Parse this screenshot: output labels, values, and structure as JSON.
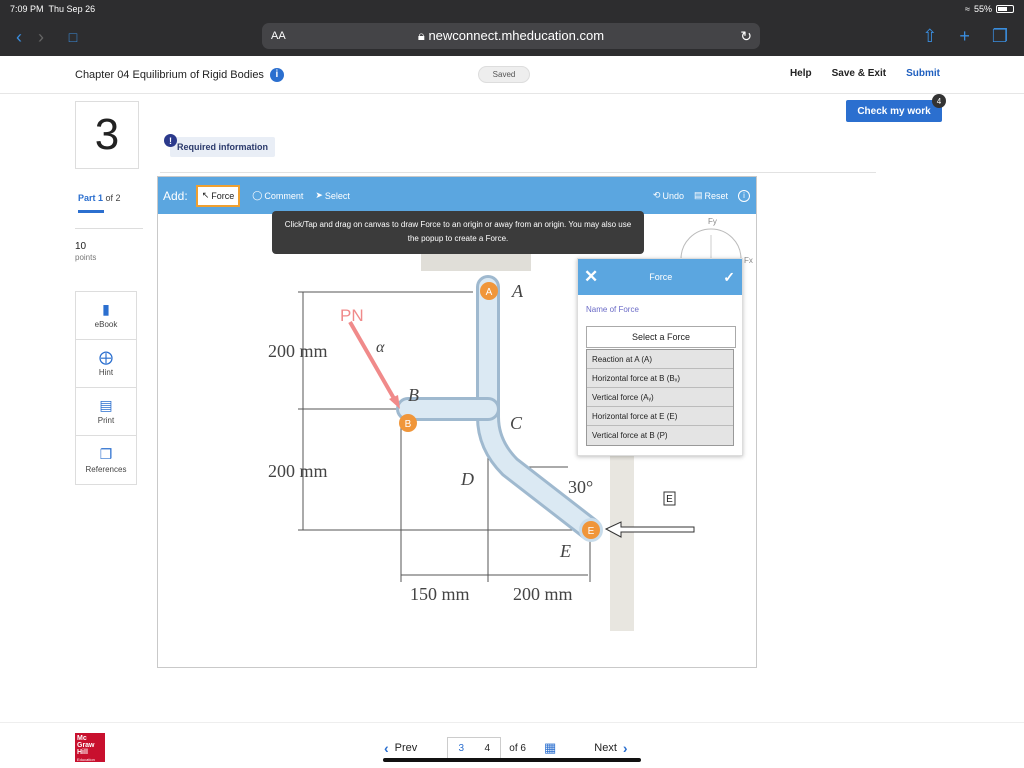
{
  "status": {
    "time": "7:09 PM",
    "date": "Thu Sep 26",
    "battery": "55%"
  },
  "browser": {
    "aa": "AA",
    "url": "newconnect.mheducation.com"
  },
  "header": {
    "chapter": "Chapter 04 Equilibrium of Rigid Bodies",
    "saved": "Saved",
    "help": "Help",
    "save_exit": "Save & Exit",
    "submit": "Submit",
    "check": "Check my work",
    "check_badge": "4"
  },
  "question": {
    "number": "3",
    "required": "Required information",
    "part_prefix": "Part ",
    "part_num": "1",
    "part_suffix": " of 2",
    "points": "10",
    "points_label": "points"
  },
  "tools": [
    {
      "label": "eBook",
      "icon": "book-icon"
    },
    {
      "label": "Hint",
      "icon": "lifebuoy-icon"
    },
    {
      "label": "Print",
      "icon": "printer-icon"
    },
    {
      "label": "References",
      "icon": "copy-icon"
    }
  ],
  "toolbar": {
    "add": "Add:",
    "force": "Force",
    "comment": "Comment",
    "select": "Select",
    "undo": "Undo",
    "reset": "Reset"
  },
  "tooltip": "Click/Tap and drag on canvas to draw Force to an origin or away from an origin. You may also use the popup to create a Force.",
  "popup": {
    "title": "Force",
    "name_label": "Name of Force",
    "select_placeholder": "Select a Force",
    "options": [
      "Reaction at A  (A)",
      "Horizontal force at B  (Bₓ)",
      "Vertical force  (Aᵧ)",
      "Horizontal force at E  (E)",
      "Vertical force at B  (P)"
    ]
  },
  "figure": {
    "axis_fy": "Fy",
    "axis_fx": "Fx",
    "label_pn": "PN",
    "alpha": "α",
    "dim_200a": "200 mm",
    "dim_200b": "200 mm",
    "dim_150": "150 mm",
    "dim_200c": "200 mm",
    "pt_a": "A",
    "pt_b": "B",
    "pt_c": "C",
    "pt_d": "D",
    "pt_e": "E",
    "angle": "30°",
    "node_a": "A",
    "node_b": "B",
    "node_e": "E",
    "e_box": "E"
  },
  "pager": {
    "prev": "Prev",
    "page_a": "3",
    "page_b": "4",
    "of": "of 6",
    "next": "Next"
  },
  "footer_logo": {
    "line1": "Mc",
    "line2": "Graw",
    "line3": "Hill",
    "line4": "Education"
  },
  "colors": {
    "accent": "#2b6fcf",
    "toolbar": "#5ba6e0",
    "node": "#f0963a",
    "arrow": "#f08a8a"
  }
}
